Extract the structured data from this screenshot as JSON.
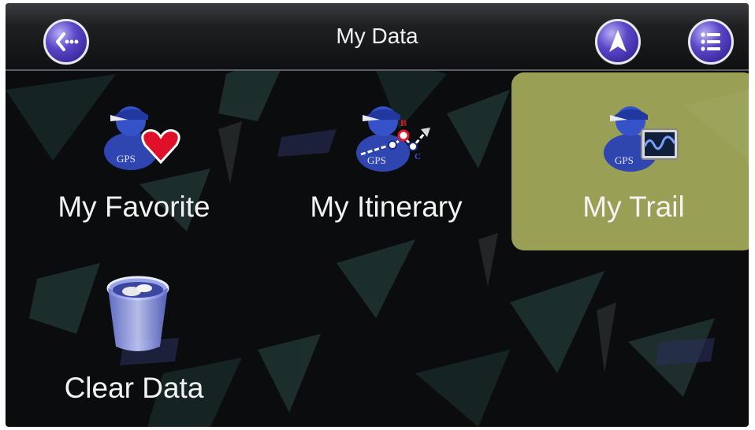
{
  "header": {
    "title": "My Data",
    "back_icon": "back-arrow-icon",
    "nav_icon": "navigation-arrow-icon",
    "menu_icon": "list-menu-icon"
  },
  "tiles": [
    {
      "label": "My Favorite",
      "icon": "gps-user-heart-icon",
      "selected": false
    },
    {
      "label": "My Itinerary",
      "icon": "gps-user-route-icon",
      "selected": false
    },
    {
      "label": "My Trail",
      "icon": "gps-user-trail-icon",
      "selected": true
    },
    {
      "label": "Clear Data",
      "icon": "trash-bin-icon",
      "selected": false
    }
  ],
  "colors": {
    "accent": "#5a46c8",
    "selected_tile": "#b4ba64",
    "background": "#0b0c0d"
  }
}
